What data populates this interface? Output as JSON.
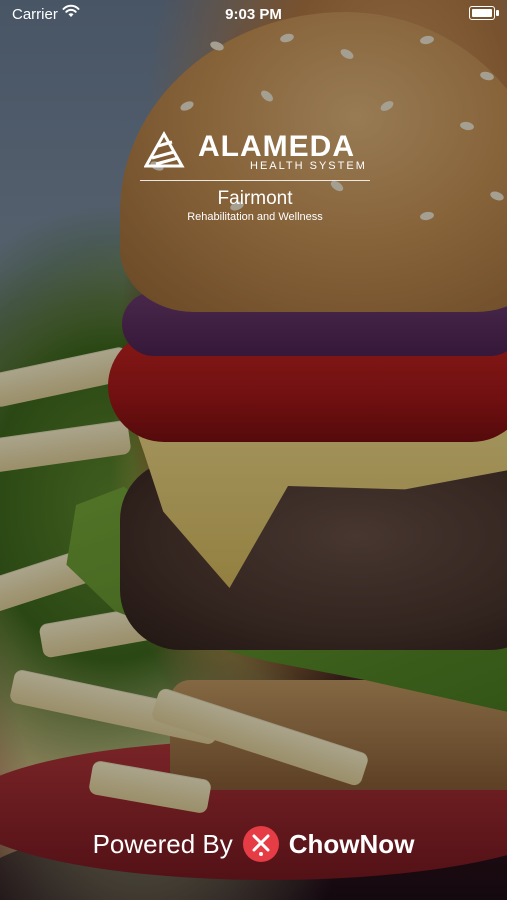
{
  "status_bar": {
    "carrier": "Carrier",
    "time": "9:03 PM",
    "icons": {
      "wifi": "wifi-icon",
      "battery": "battery-icon"
    }
  },
  "branding": {
    "organization": "ALAMEDA",
    "organization_sub": "HEALTH SYSTEM",
    "location_name": "Fairmont",
    "location_description": "Rehabilitation and Wellness",
    "logo_icon": "alameda-logo-icon"
  },
  "footer": {
    "powered_label": "Powered By",
    "brand": "ChowNow",
    "brand_icon": "chownow-logo-icon",
    "brand_color": "#e63c46"
  },
  "colors": {
    "text": "#ffffff",
    "overlay": "rgba(0,0,0,0.32)"
  }
}
